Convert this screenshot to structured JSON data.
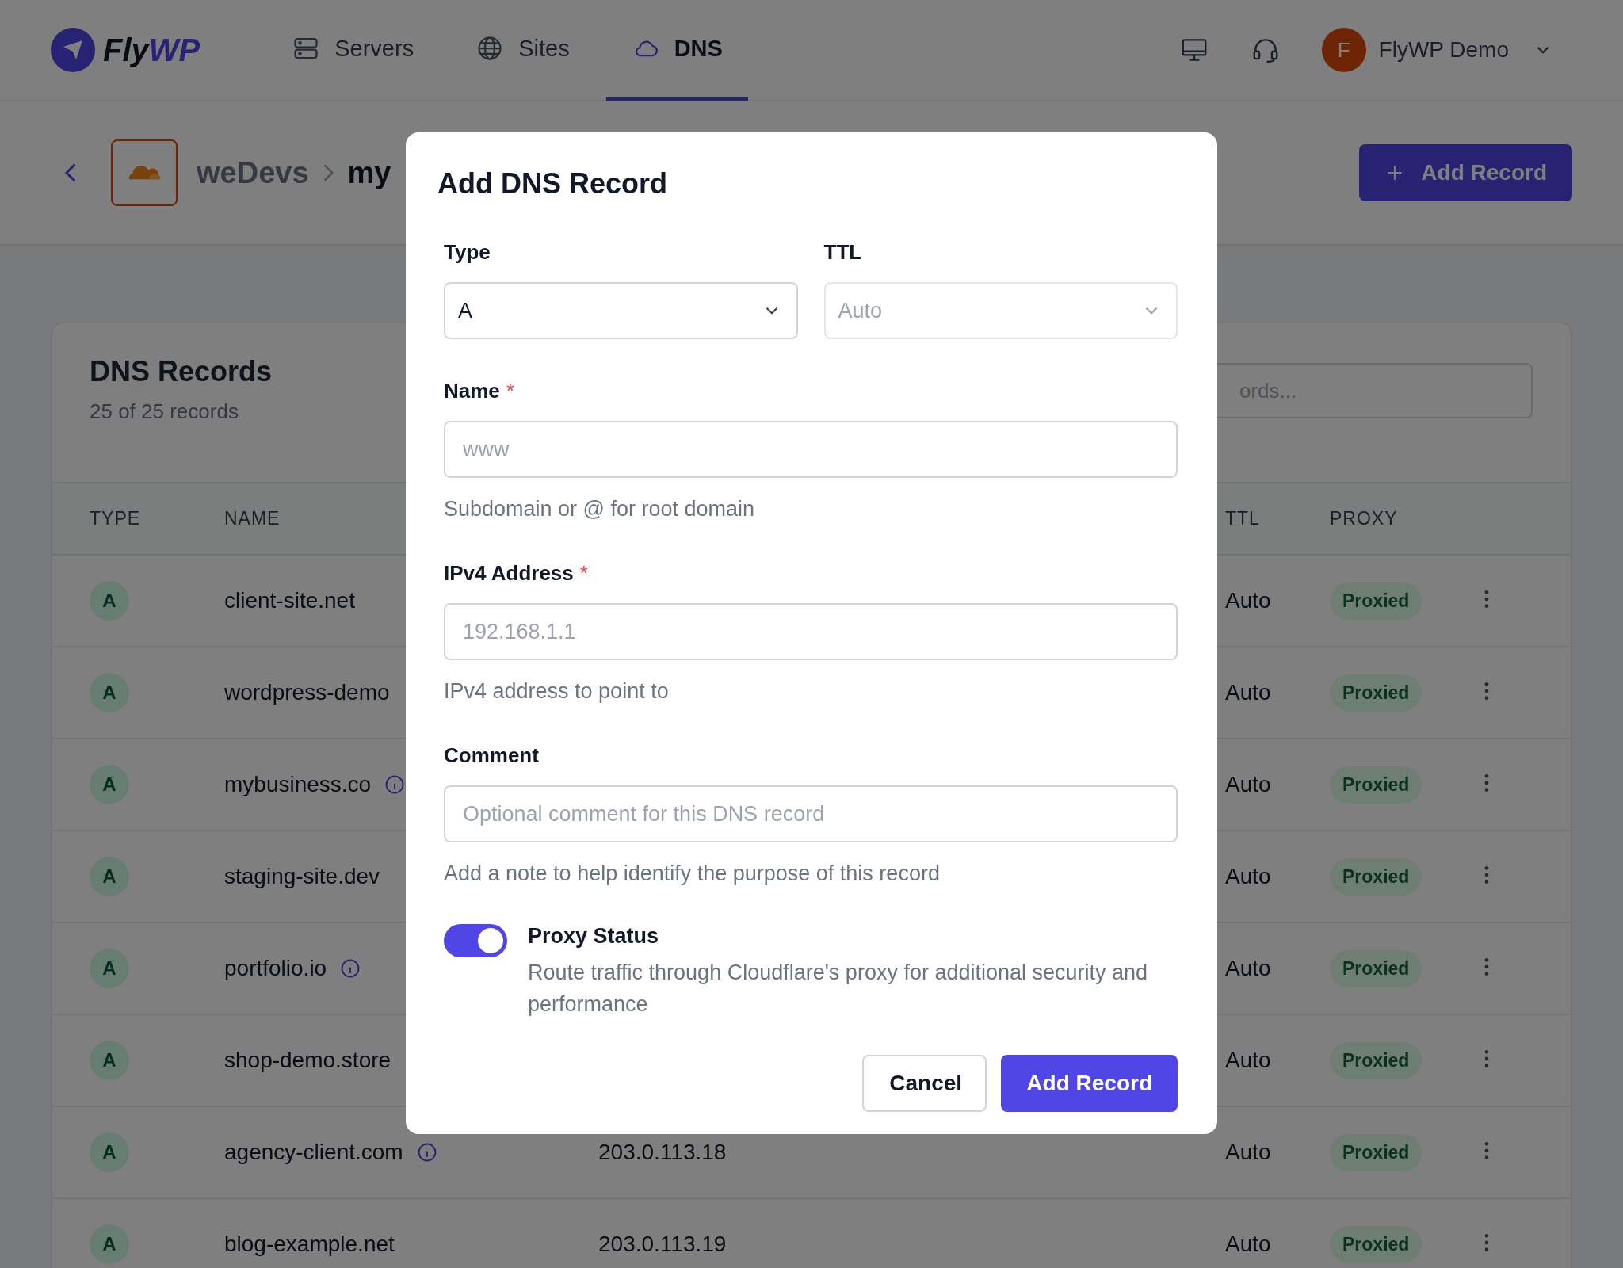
{
  "header": {
    "logo": {
      "text_main": "Fly",
      "text_accent": "WP"
    },
    "nav": [
      {
        "label": "Servers",
        "selected": false
      },
      {
        "label": "Sites",
        "selected": false
      },
      {
        "label": "DNS",
        "selected": true
      }
    ],
    "user": {
      "initial": "F",
      "name": "FlyWP Demo"
    }
  },
  "breadcrumb": {
    "items": [
      "weDevs",
      "my"
    ]
  },
  "add_record_button": "Add Record",
  "records_card": {
    "title": "DNS Records",
    "subtitle": "25 of 25 records",
    "search_placeholder": "ords...",
    "columns": [
      "TYPE",
      "NAME",
      "TTL",
      "PROXY"
    ],
    "rows": [
      {
        "type": "A",
        "name": "client-site.net",
        "info": false,
        "ttl": "Auto",
        "proxy": "Proxied"
      },
      {
        "type": "A",
        "name": "wordpress-demo",
        "info": false,
        "ttl": "Auto",
        "proxy": "Proxied"
      },
      {
        "type": "A",
        "name": "mybusiness.co",
        "info": true,
        "ttl": "Auto",
        "proxy": "Proxied"
      },
      {
        "type": "A",
        "name": "staging-site.dev",
        "info": false,
        "ttl": "Auto",
        "proxy": "Proxied"
      },
      {
        "type": "A",
        "name": "portfolio.io",
        "info": true,
        "ttl": "Auto",
        "proxy": "Proxied"
      },
      {
        "type": "A",
        "name": "shop-demo.store",
        "info": false,
        "ttl": "Auto",
        "proxy": "Proxied"
      },
      {
        "type": "A",
        "name": "agency-client.com",
        "info": true,
        "content": "203.0.113.18",
        "ttl": "Auto",
        "proxy": "Proxied"
      },
      {
        "type": "A",
        "name": "blog-example.net",
        "info": false,
        "content": "203.0.113.19",
        "ttl": "Auto",
        "proxy": "Proxied"
      }
    ]
  },
  "modal": {
    "title": "Add DNS Record",
    "selects": [
      {
        "label": "Type",
        "value": "A",
        "disabled": false
      },
      {
        "label": "TTL",
        "value": "Auto",
        "disabled": true
      }
    ],
    "fields": [
      {
        "label": "Name",
        "required_mark": "*",
        "placeholder": "www",
        "help": "Subdomain or @ for root domain"
      },
      {
        "label": "IPv4 Address",
        "required_mark": "*",
        "placeholder": "192.168.1.1",
        "help": "IPv4 address to point to"
      },
      {
        "label": "Comment",
        "placeholder": "Optional comment for this DNS record",
        "help": "Add a note to help identify the purpose of this record"
      }
    ],
    "proxy_toggle": {
      "on": true,
      "label": "Proxy Status",
      "description": "Route traffic through Cloudflare's proxy for additional security and performance"
    },
    "buttons": [
      {
        "label": "Cancel",
        "kind": "secondary"
      },
      {
        "label": "Add Record",
        "kind": "primary"
      }
    ]
  }
}
